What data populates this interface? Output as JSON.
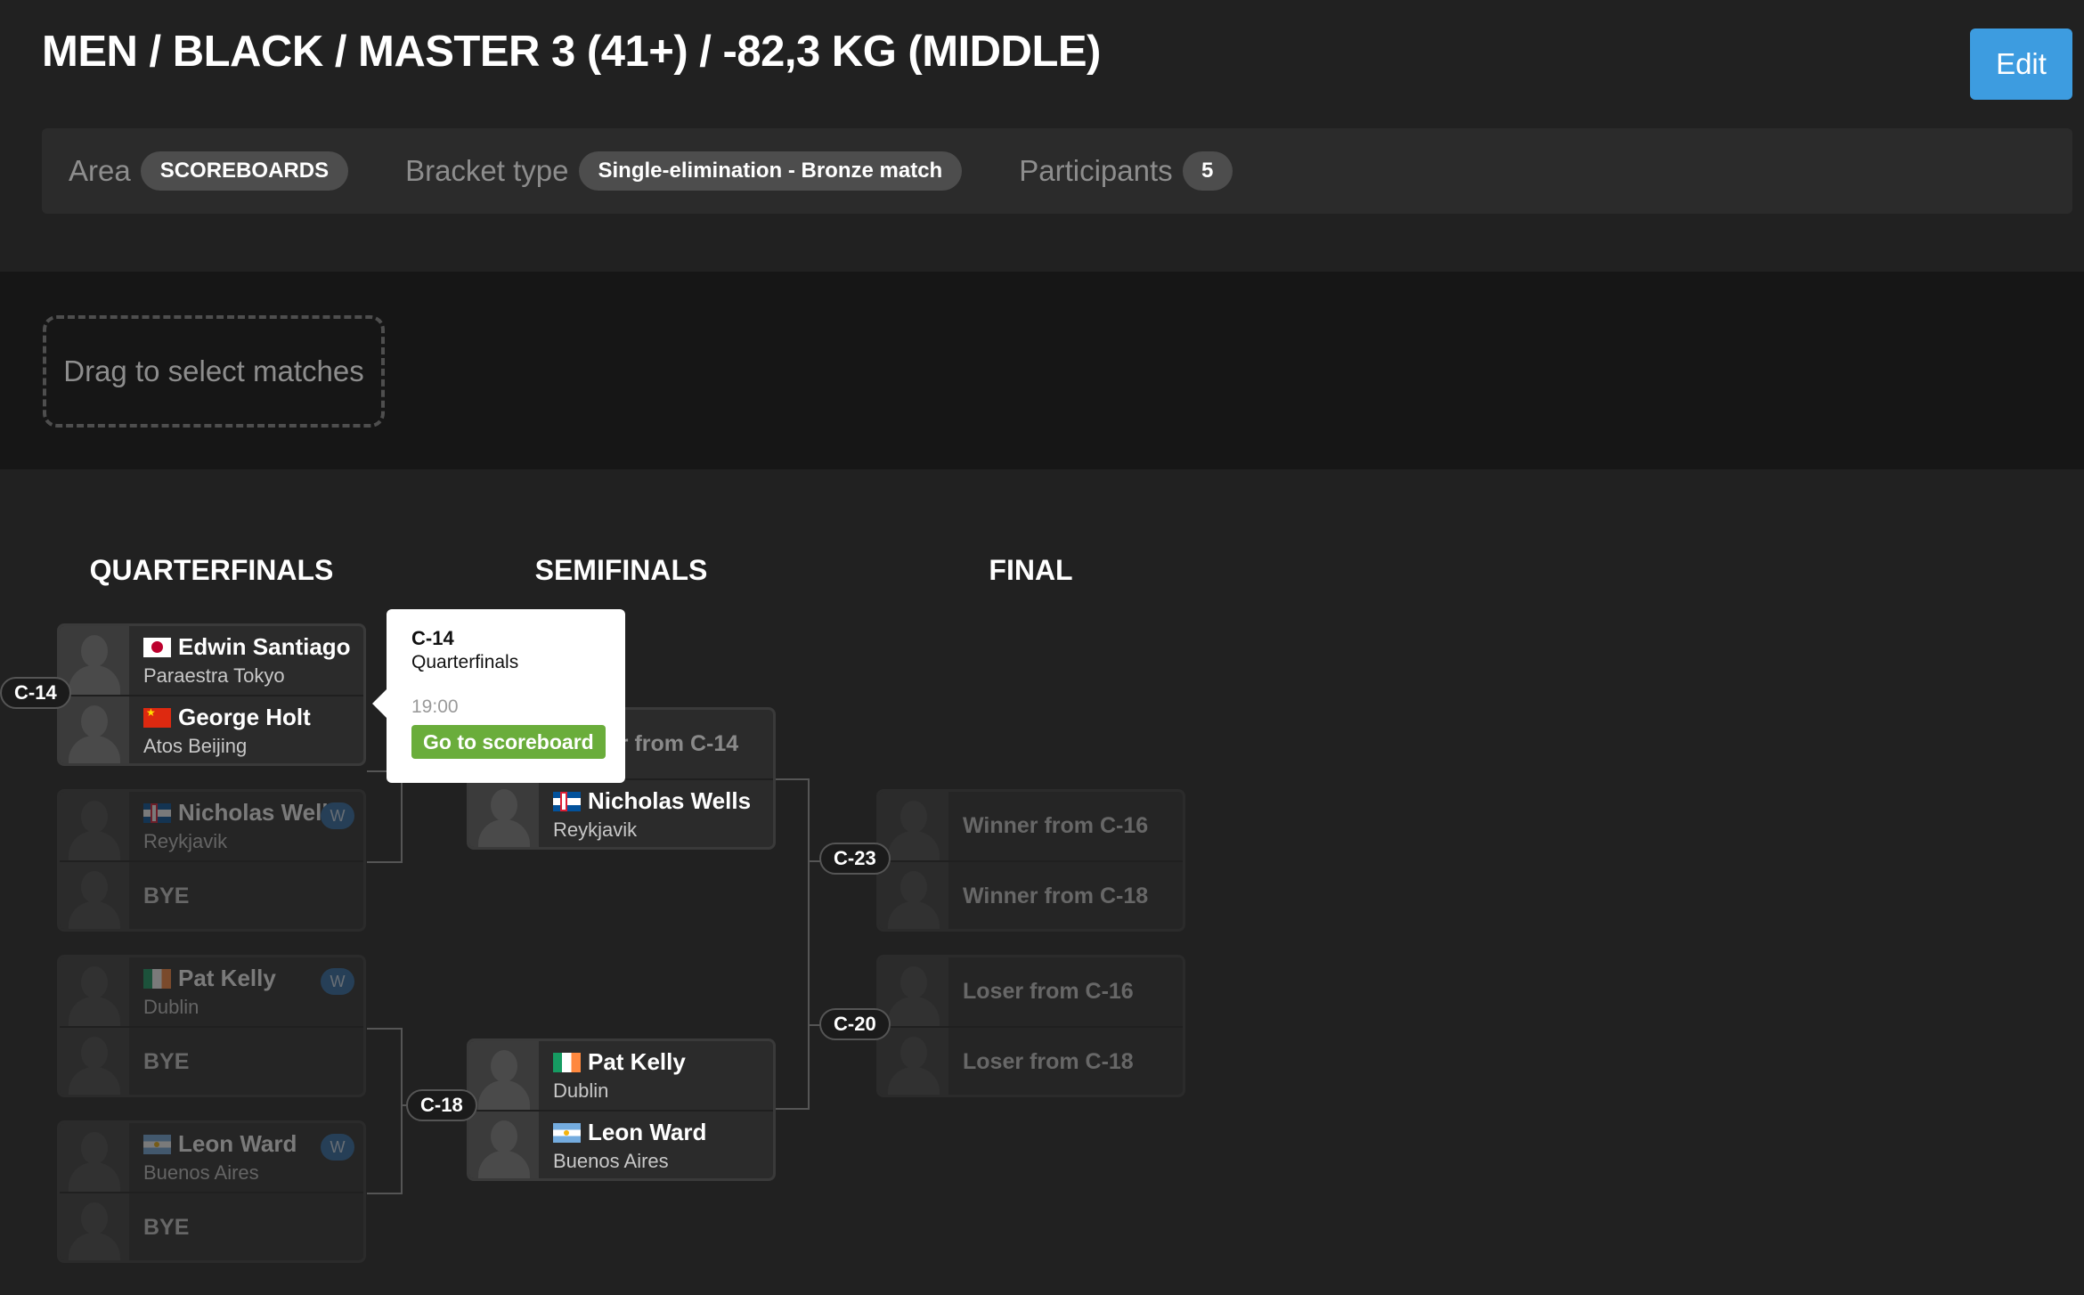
{
  "header": {
    "title": "MEN / BLACK / MASTER 3 (41+) / -82,3 KG (MIDDLE)",
    "edit_label": "Edit"
  },
  "info": {
    "area_label": "Area",
    "area_value": "SCOREBOARDS",
    "bracket_label": "Bracket type",
    "bracket_value": "Single-elimination - Bronze match",
    "participants_label": "Participants",
    "participants_value": "5"
  },
  "drag": {
    "label": "Drag to select matches"
  },
  "rounds": {
    "quarterfinals": "QUARTERFINALS",
    "semifinals": "SEMIFINALS",
    "final": "FINAL"
  },
  "bye_label": "BYE",
  "win_badge": "W",
  "matches": {
    "c14": {
      "tag": "C-14",
      "p1": {
        "name": "Edwin Santiago",
        "club": "Paraestra Tokyo",
        "flag": "flag-jp"
      },
      "p2": {
        "name": "George Holt",
        "club": "Atos Beijing",
        "flag": "flag-cn"
      }
    },
    "qf2": {
      "p1": {
        "name": "Nicholas Wells",
        "club": "Reykjavik",
        "flag": "flag-is"
      }
    },
    "qf3": {
      "p1": {
        "name": "Pat Kelly",
        "club": "Dublin",
        "flag": "flag-ie"
      }
    },
    "qf4": {
      "p1": {
        "name": "Leon Ward",
        "club": "Buenos Aires",
        "flag": "flag-ar"
      }
    },
    "sf1": {
      "p1": {
        "placeholder": "Winner from C-14"
      },
      "p2": {
        "name": "Nicholas Wells",
        "club": "Reykjavik",
        "flag": "flag-is"
      }
    },
    "c18": {
      "tag": "C-18",
      "p1": {
        "name": "Pat Kelly",
        "club": "Dublin",
        "flag": "flag-ie"
      },
      "p2": {
        "name": "Leon Ward",
        "club": "Buenos Aires",
        "flag": "flag-ar"
      }
    },
    "c23": {
      "tag": "C-23",
      "p1": "Winner from C-16",
      "p2": "Winner from C-18"
    },
    "c20": {
      "tag": "C-20",
      "p1": "Loser from C-16",
      "p2": "Loser from C-18"
    }
  },
  "tooltip": {
    "id": "C-14",
    "round": "Quarterfinals",
    "time": "19:00",
    "button": "Go to scoreboard"
  }
}
